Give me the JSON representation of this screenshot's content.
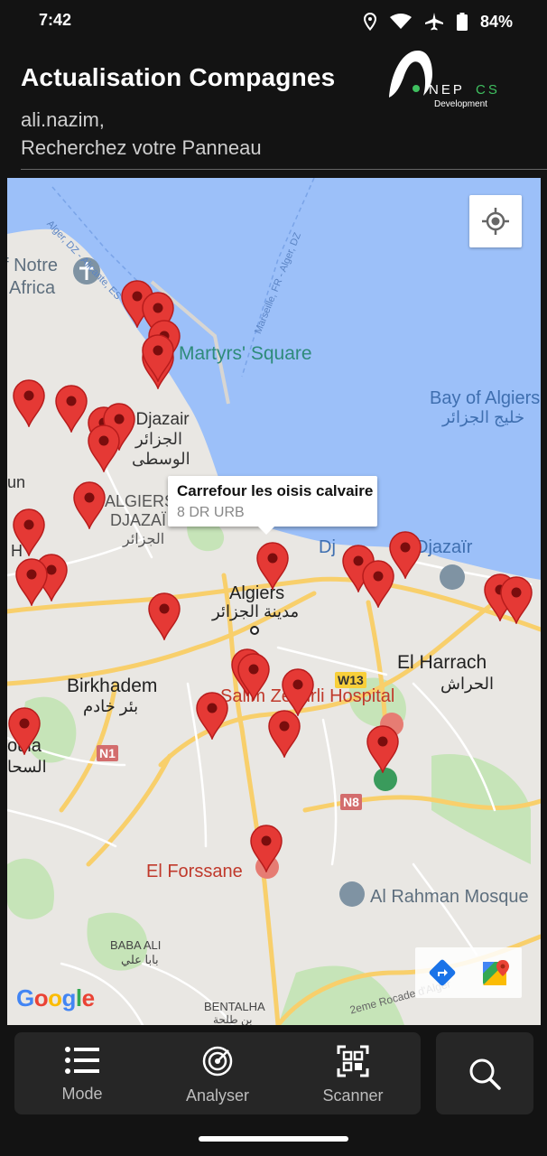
{
  "status_bar": {
    "time": "7:42",
    "battery": "84%"
  },
  "header": {
    "title": "Actualisation Compagnes",
    "user": "ali.nazim,",
    "search_hint": "Recherchez votre Panneau",
    "logo": {
      "name": "NEPCS",
      "sub": "Development"
    }
  },
  "map": {
    "labels": {
      "notre1": "f Notre",
      "notre2": "Africa",
      "martyrs": "Martyrs' Square",
      "bay_en": "Bay of Algiers",
      "bay_ar": "خليج الجزائر",
      "djazair1": "l Djazair",
      "djazair2": "الجزائر",
      "djazair3": "الوسطى",
      "un": "un",
      "algiers_cap1": "ALGIERS",
      "algiers_cap2": "DJAZAÏ",
      "algiers_cap3": "الجزائر",
      "h": "H",
      "djazair_right": "Djazaïr",
      "dj_left": "Dj",
      "algiers": "Algiers",
      "algiers_ar": "مدينة الجزائر",
      "el_harrach": "El Harrach",
      "el_harrach_ar": "الحراش",
      "birkhadem": "Birkhadem",
      "birkhadem_ar": "بئر خادم",
      "hospital": "Salim Zemirli Hospital",
      "road_w13": "W13",
      "road_n1": "N1",
      "road_n8": "N8",
      "oula": "oula",
      "oula_ar": "السحا",
      "forssane": "El Forssane",
      "mosque": "Al Rahman Mosque",
      "baba_ali": "BABA ALI",
      "baba_ali_ar": "بابا علي",
      "bentalha": "BENTALHA",
      "bentalha_ar": "بن طلحة",
      "rocade": "2eme Rocade d'Alger",
      "cable1": "Alger, DZ - Alicante, ES",
      "cable2": "Marseille, FR - Alger, DZ"
    },
    "info_window": {
      "title": "Carrefour les oisis calvaire",
      "subtitle": "8 DR URB"
    },
    "google": "Google",
    "colors": {
      "water": "#9cc0f9",
      "land": "#e9e7e3",
      "park": "#c6e4b8",
      "road": "#f8cf6b",
      "pin": "#e53935"
    }
  },
  "bottom_nav": {
    "items": [
      {
        "label": "Mode",
        "icon": "list-icon"
      },
      {
        "label": "Analyser",
        "icon": "radar-icon"
      },
      {
        "label": "Scanner",
        "icon": "qr-scan-icon"
      }
    ],
    "search_icon": "search-icon"
  }
}
